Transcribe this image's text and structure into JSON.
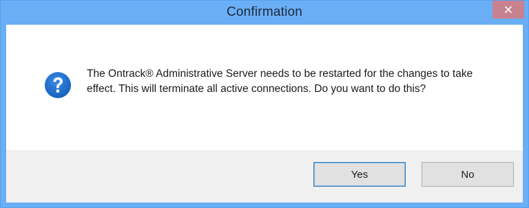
{
  "dialog": {
    "title": "Confirmation",
    "close_symbol": "×",
    "icon": "question-icon",
    "message": "The Ontrack® Administrative Server needs to be restarted for the changes to take effect. This will terminate all active connections. Do you want to do this?",
    "buttons": {
      "yes_label": "Yes",
      "no_label": "No"
    }
  },
  "colors": {
    "titlebar": "#6aaef6",
    "close_button": "#c8828f",
    "icon_fill": "#1f6fd0",
    "button_area": "#f0f0f0"
  }
}
